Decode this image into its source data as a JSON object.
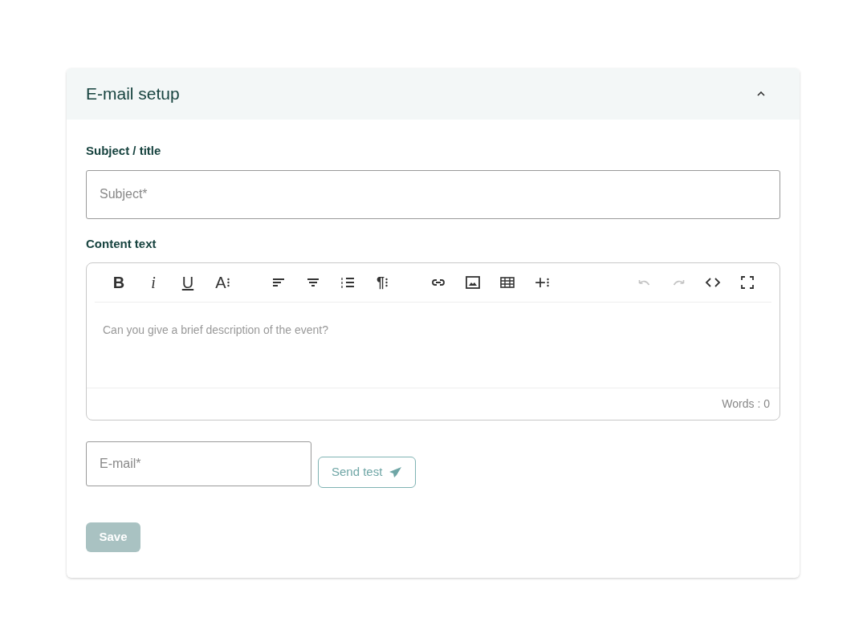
{
  "panel": {
    "title": "E-mail setup",
    "expanded": true
  },
  "subject": {
    "label": "Subject / title",
    "placeholder": "Subject*"
  },
  "content": {
    "label": "Content text",
    "placeholder": "Can you give a brief description of the event?",
    "word_count": "Words : 0"
  },
  "toolbar": {
    "groups": [
      {
        "items": [
          {
            "kind": "bold",
            "label": "B",
            "disabled": false
          },
          {
            "kind": "italic",
            "label": "i",
            "disabled": false
          },
          {
            "kind": "underline",
            "label": "U",
            "disabled": false
          },
          {
            "kind": "font-size",
            "label": "A",
            "disabled": false
          }
        ]
      },
      {
        "items": [
          {
            "kind": "align-left",
            "disabled": false
          },
          {
            "kind": "align-center",
            "disabled": false
          },
          {
            "kind": "list",
            "disabled": false
          },
          {
            "kind": "paragraph",
            "label": "¶",
            "disabled": false
          }
        ]
      },
      {
        "items": [
          {
            "kind": "link",
            "disabled": false
          },
          {
            "kind": "image",
            "disabled": false
          },
          {
            "kind": "table",
            "disabled": false
          },
          {
            "kind": "insert",
            "label": "+",
            "disabled": false
          }
        ]
      },
      {
        "items": [
          {
            "kind": "undo",
            "disabled": true
          },
          {
            "kind": "redo",
            "disabled": true
          },
          {
            "kind": "code",
            "disabled": false
          },
          {
            "kind": "fullscreen",
            "disabled": false
          }
        ]
      }
    ]
  },
  "email": {
    "placeholder": "E-mail*"
  },
  "send_test": {
    "label": "Send test"
  },
  "save": {
    "label": "Save",
    "disabled": true
  }
}
